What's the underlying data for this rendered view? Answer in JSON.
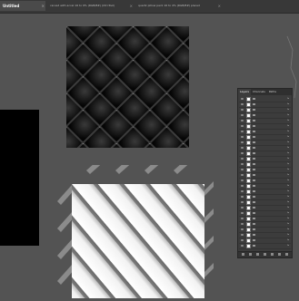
{
  "window": {
    "tabs": [
      {
        "label": "Untitled",
        "active": true
      },
      {
        "label": "carved with accel 16 to 9% (RGB/8#) (Ctrl-Tool)"
      },
      {
        "label": "quartz pillow pack 16 to 4% (RGB/8#) placed"
      },
      {
        "label": ""
      }
    ]
  },
  "layers_panel": {
    "tabs": [
      "Layers",
      "Channels",
      "Paths",
      "Properties"
    ],
    "rows_count_label": "",
    "layer_name": "",
    "fx_label": "fx"
  },
  "colors": {
    "workspace": "#535353",
    "tabbar": "#383838",
    "panel": "#3c3c3c",
    "quilted_pattern_bg": "#1a1a1a",
    "white_tile": "#ffffff",
    "black_block": "#000000"
  },
  "icons": [
    "close-icon",
    "eye-icon",
    "link-icon",
    "fx-icon",
    "new-layer-icon",
    "trash-icon"
  ]
}
